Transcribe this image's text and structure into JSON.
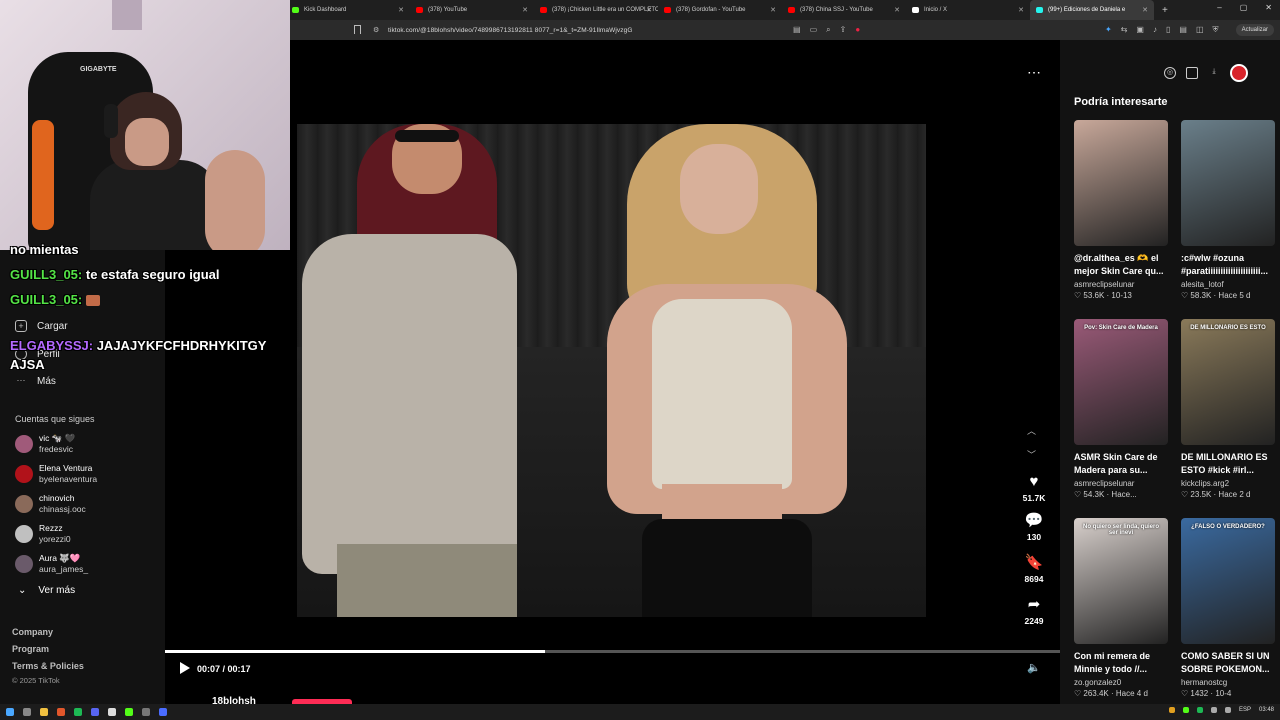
{
  "browser": {
    "tabs": [
      {
        "label": "Kick Dashboard",
        "color": "#53fc18",
        "active": false
      },
      {
        "label": "(378) YouTube",
        "color": "#ff0000",
        "active": false
      },
      {
        "label": "(378) ¡Chicken Little era un COMPLETO",
        "color": "#ff0000",
        "active": false
      },
      {
        "label": "(378) Gordofan - YouTube",
        "color": "#ff0000",
        "active": false
      },
      {
        "label": "(378) China SSJ - YouTube",
        "color": "#ff0000",
        "active": false
      },
      {
        "label": "Inicio / X",
        "color": "#ffffff",
        "active": false
      },
      {
        "label": "(99+) Ediciones de Daniela e",
        "color": "#25f4ee",
        "active": true
      }
    ],
    "new_tab": "+",
    "url": "tiktok.com/@18blohsh/video/7489986713192811 8077_r=1&_t=ZM-91IlmaWjvzgG",
    "update_label": "Actualizar"
  },
  "sidenav": {
    "items": [
      {
        "label": "Cargar",
        "icon": "upload-icon"
      },
      {
        "label": "Perfil",
        "icon": "profile-icon"
      },
      {
        "label": "Más",
        "icon": "more-icon"
      }
    ],
    "following_title": "Cuentas que sigues",
    "following": [
      {
        "name": "vic 🐄 🖤",
        "handle": "fredesvic",
        "color": "#a05a7a"
      },
      {
        "name": "Elena Ventura",
        "handle": "byelenaventura",
        "color": "#b1121a"
      },
      {
        "name": "chinovich",
        "handle": "chinassj.ooc",
        "color": "#8a6a5a"
      },
      {
        "name": "Rezzz",
        "handle": "yorezzi0",
        "color": "#c0c0c0"
      },
      {
        "name": "Aura 🐺🩷",
        "handle": "aura_james_",
        "color": "#6a5a6a"
      }
    ],
    "see_more": "Ver más",
    "footer_links": [
      "Company",
      "Program",
      "Terms & Policies"
    ],
    "copyright": "© 2025 TikTok"
  },
  "video": {
    "time": "00:07 / 00:17",
    "progress": 0.425,
    "author": "18blohsh",
    "actions": [
      {
        "icon": "heart-icon",
        "glyph": "♥",
        "count": "51.7K"
      },
      {
        "icon": "comment-icon",
        "glyph": "💬",
        "count": "130"
      },
      {
        "icon": "bookmark-icon",
        "glyph": "🔖",
        "count": "8694"
      },
      {
        "icon": "share-icon",
        "glyph": "➦",
        "count": "2249"
      }
    ]
  },
  "reco": {
    "title": "Podría interesarte",
    "cards": [
      {
        "title": "@dr.althea_es 🫶 el mejor Skin Care qu...",
        "user": "asmreclipselunar",
        "likes": "53.6K",
        "date": "10-13",
        "bg": "#c8a89a",
        "overlay": ""
      },
      {
        "title": ":c#wlw #ozuna #paratiiiiiiiiiiiiiiiiiiiii...",
        "user": "alesita_lotof",
        "likes": "58.3K",
        "date": "Hace 5 d",
        "bg": "#6a7f8a",
        "overlay": ""
      },
      {
        "title": "ASMR Skin Care de Madera para su...",
        "user": "asmreclipselunar",
        "likes": "54.3K",
        "date": "Hace...",
        "bg": "#9a5a78",
        "overlay": "Pov: Skin Care de Madera"
      },
      {
        "title": "DE MILLONARIO ES ESTO #kick #irl...",
        "user": "kickclips.arg2",
        "likes": "23.5K",
        "date": "Hace 2 d",
        "bg": "#8a7a5a",
        "overlay": "DE MILLONARIO ES ESTO"
      },
      {
        "title": "Con mi remera de Minnie y todo //...",
        "user": "zo.gonzalez0",
        "likes": "263.4K",
        "date": "Hace 4 d",
        "bg": "#d8d0cc",
        "overlay": "No quiero ser linda, quiero ser inevi"
      },
      {
        "title": "COMO SABER SI UN SOBRE POKEMON...",
        "user": "hermanostcg",
        "likes": "1432",
        "date": "10-4",
        "bg": "#3a6aa0",
        "overlay": "¿FALSO O VERDADERO?"
      }
    ]
  },
  "chat": [
    {
      "name": "",
      "text": "no mientas",
      "color": "white"
    },
    {
      "name": "GUILL3_05:",
      "text": "te estafa seguro igual",
      "color": "green"
    },
    {
      "name": "GUILL3_05:",
      "text": "",
      "color": "green",
      "emote": true
    },
    {
      "name": "ELGABYSSJ:",
      "text": "JAJAJYKFCFHDRHYKITGY",
      "color": "purple"
    },
    {
      "name": "",
      "text": "AJSA",
      "color": "white"
    }
  ],
  "webcam": {
    "chair_brand": "GIGABYTE"
  },
  "taskbar": {
    "lang": "ESP",
    "clock": "03:48"
  }
}
